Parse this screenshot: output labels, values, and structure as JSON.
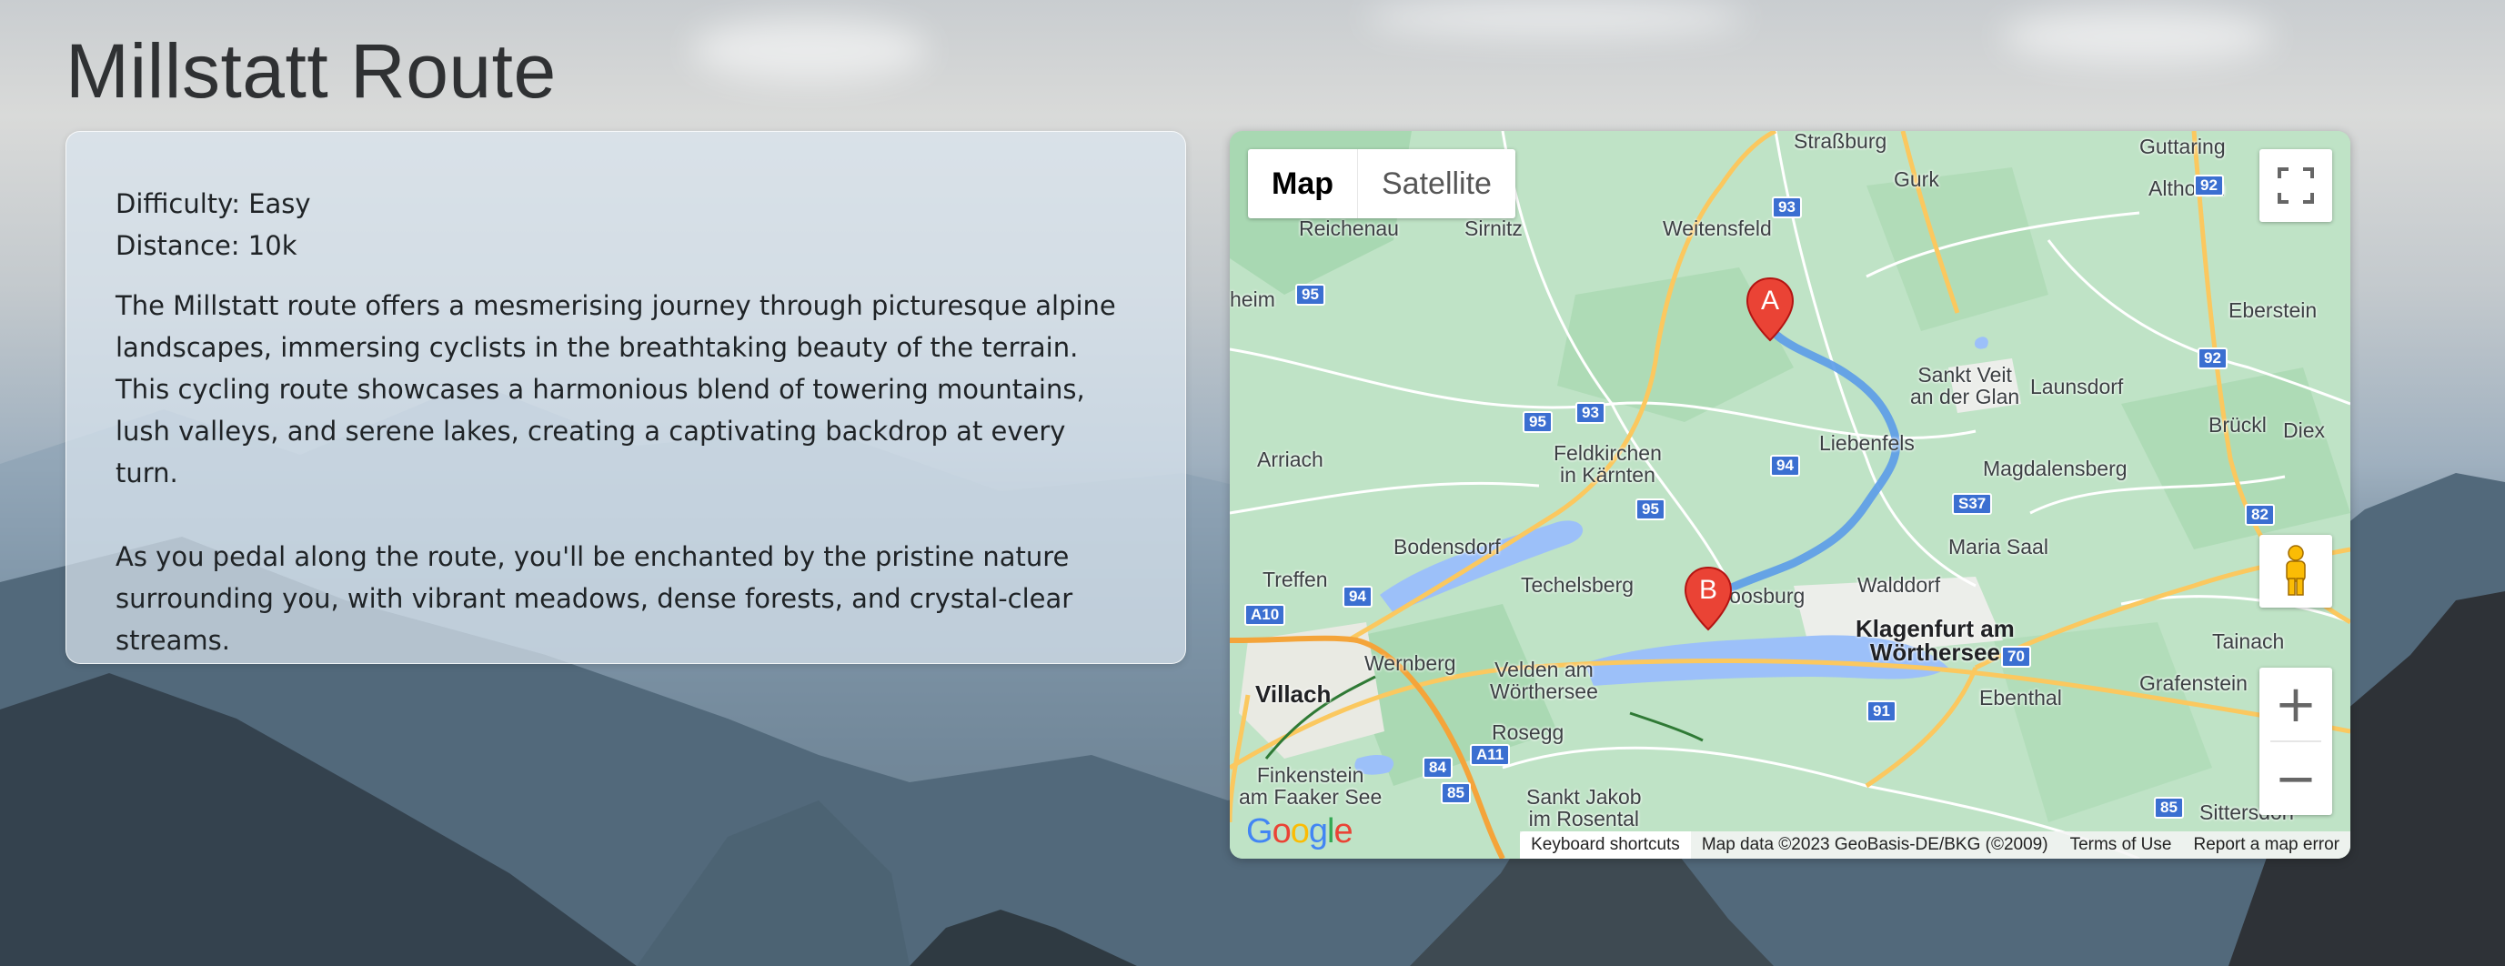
{
  "page": {
    "title": "Millstatt Route"
  },
  "info": {
    "difficulty": "Difficulty: Easy",
    "distance": "Distance: 10k",
    "paragraph1": "The Millstatt route offers a mesmerising journey through picturesque alpine landscapes, immersing cyclists in the breathtaking beauty of the terrain. This cycling route showcases a harmonious blend of towering mountains, lush valleys, and serene lakes, creating a captivating backdrop at every turn.",
    "paragraph2": "As you pedal along the route, you'll be enchanted by the pristine nature surrounding you, with vibrant meadows, dense forests, and crystal-clear streams."
  },
  "map": {
    "type_controls": {
      "map_label": "Map",
      "satellite_label": "Satellite",
      "selected": "Map"
    },
    "markers": {
      "start": "A",
      "end": "B"
    },
    "places": {
      "strasburg": "Straßburg",
      "guttaring": "Guttaring",
      "gurk": "Gurk",
      "althofen": "Althofen",
      "reichenau": "Reichenau",
      "sirnitz": "Sirnitz",
      "weitensfeld": "Weitensfeld",
      "eberstein": "Eberstein",
      "heim": "heim",
      "sankt_veit_1": "Sankt Veit",
      "sankt_veit_2": "an der Glan",
      "launsdorf": "Launsdorf",
      "bruckl": "Brückl",
      "diex": "Diex",
      "arriach": "Arriach",
      "feldkirchen_1": "Feldkirchen",
      "feldkirchen_2": "in Kärnten",
      "liebenfels": "Liebenfels",
      "magdalensberg": "Magdalensberg",
      "bodensdorf": "Bodensdorf",
      "maria_saal": "Maria Saal",
      "treffen": "Treffen",
      "techelsberg": "Techelsberg",
      "moosburg": "Moosburg",
      "walddorf": "Walddorf",
      "klagenfurt_1": "Klagenfurt am",
      "klagenfurt_2": "Wörthersee",
      "tainach": "Tainach",
      "wernberg": "Wernberg",
      "velden_1": "Velden am",
      "velden_2": "Wörthersee",
      "villach": "Villach",
      "ebenthal": "Ebenthal",
      "grafenstein": "Grafenstein",
      "rosegg": "Rosegg",
      "finkenstein_1": "Finkenstein",
      "finkenstein_2": "am Faaker See",
      "sankt_jakob_1": "Sankt Jakob",
      "sankt_jakob_2": "im Rosental",
      "sittersdorf": "Sittersdorf"
    },
    "road_shields": {
      "r93a": "93",
      "r92a": "92",
      "r95a": "95",
      "r92b": "92",
      "r95b": "95",
      "r93b": "93",
      "r94a": "94",
      "rs37": "S37",
      "r95c": "95",
      "r82": "82",
      "r94b": "94",
      "ra10": "A10",
      "r70": "70",
      "r91": "91",
      "ra11": "A11",
      "r84": "84",
      "r85a": "85",
      "r85b": "85"
    },
    "attribution": {
      "keyboard": "Keyboard shortcuts",
      "data": "Map data ©2023 GeoBasis-DE/BKG (©2009)",
      "terms": "Terms of Use",
      "report": "Report a map error"
    },
    "logo": {
      "g1": "G",
      "o1": "o",
      "o2": "o",
      "g2": "g",
      "l": "l",
      "e": "e"
    },
    "colors": {
      "land": "#bfe3c6",
      "water": "#9cc0f9",
      "route": "#5b9be8",
      "marker": "#ea4335",
      "major_road": "#fbc85f"
    }
  }
}
